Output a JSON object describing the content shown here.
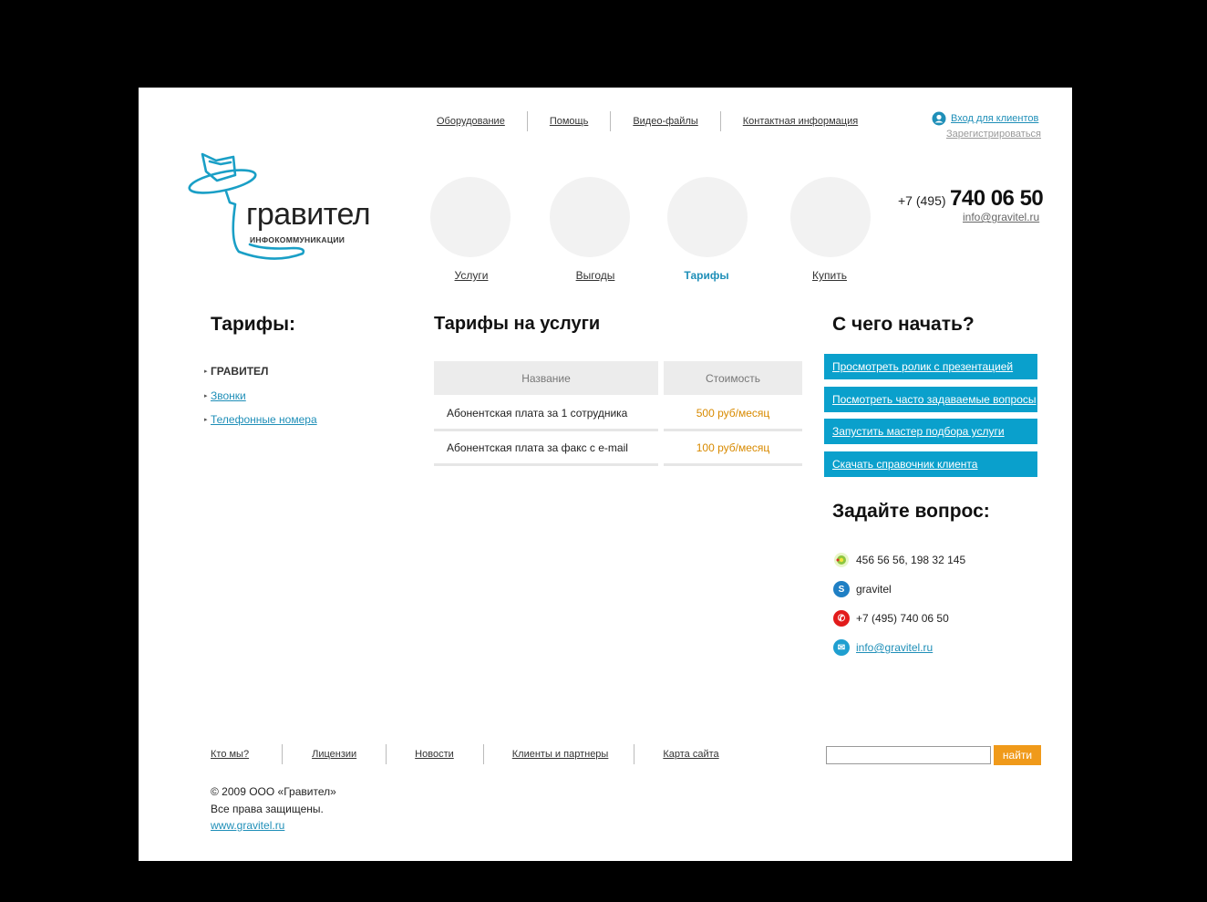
{
  "header": {
    "top_nav": [
      "Оборудование",
      "Помощь",
      "Видео-файлы",
      "Контактная информация"
    ],
    "login_label": "Вход для клиентов",
    "register_label": "Зарегистрироваться",
    "logo_title": "гравител",
    "logo_subtitle": "ИНФОКОММУНИКАЦИИ",
    "phone_code": "+7 (495)",
    "phone_number": "740 06 50",
    "email": "info@gravitel.ru"
  },
  "main_nav": [
    {
      "label": "Услуги",
      "active": false
    },
    {
      "label": "Выгоды",
      "active": false
    },
    {
      "label": "Тарифы",
      "active": true
    },
    {
      "label": "Купить",
      "active": false
    }
  ],
  "sidebar": {
    "heading": "Тарифы:",
    "items": [
      {
        "label": "ГРАВИТЕЛ",
        "active": true
      },
      {
        "label": "Звонки",
        "active": false
      },
      {
        "label": "Телефонные номера",
        "active": false
      }
    ]
  },
  "content": {
    "heading": "Тарифы на услуги",
    "table": {
      "columns": [
        "Название",
        "Стоимость"
      ],
      "rows": [
        [
          "Абонентская плата за 1 сотрудника",
          "500 руб/месяц"
        ],
        [
          "Абонентская плата за факс с e-mail",
          "100 руб/месяц"
        ]
      ]
    }
  },
  "right": {
    "start_heading": "С чего начать?",
    "start_buttons": [
      "Просмотреть ролик с презентацией",
      "Посмотреть часто задаваемые вопросы",
      "Запустить мастер подбора услуги",
      "Скачать справочник клиента"
    ],
    "ask_heading": "Задайте вопрос:",
    "contacts": [
      {
        "icon": "icq-icon",
        "text": "456 56 56, 198 32 145"
      },
      {
        "icon": "skype-icon",
        "text": "gravitel"
      },
      {
        "icon": "phone-icon",
        "text": "+7 (495) 740 06 50"
      },
      {
        "icon": "mail-icon",
        "text": "info@gravitel.ru"
      }
    ]
  },
  "footer": {
    "nav": [
      "Кто мы?",
      "Лицензии",
      "Новости",
      "Клиенты и партнеры",
      "Карта сайта"
    ],
    "search_button": "найти",
    "search_value": "",
    "copyright": "© 2009 ООО «Гравител»",
    "rights": "Все права защищены.",
    "site": "www.gravitel.ru"
  },
  "colors": {
    "accent_blue": "#0aa0cc",
    "link_blue": "#1f8fb8",
    "price_orange": "#d88a00",
    "search_button": "#f09a1a",
    "frame": "#000000"
  }
}
